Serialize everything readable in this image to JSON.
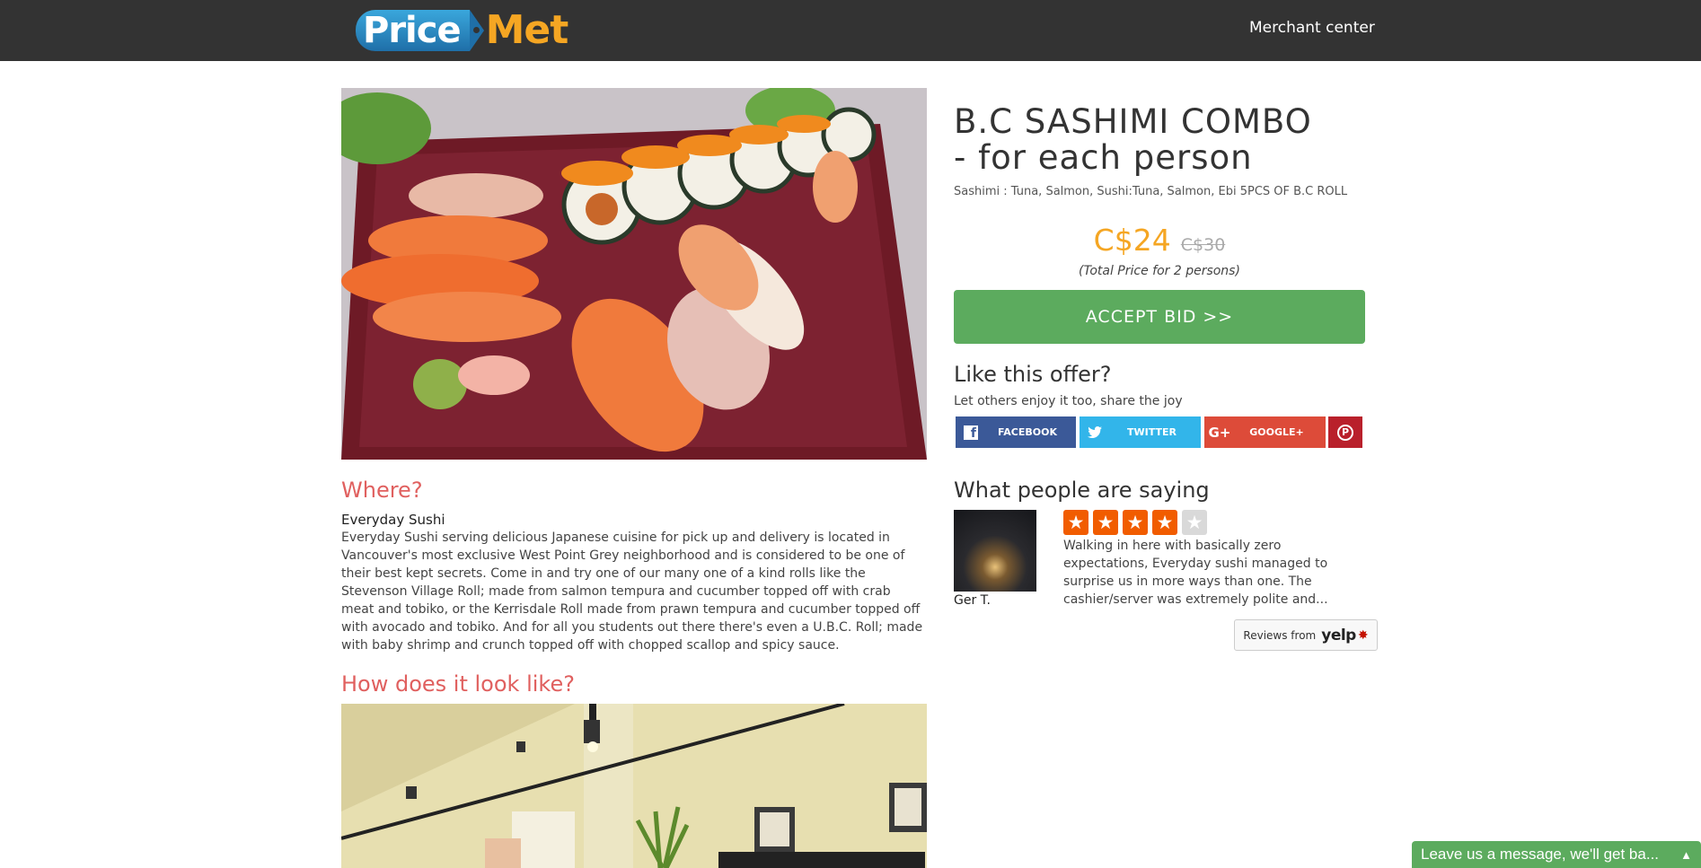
{
  "header": {
    "logo_part1": "Price",
    "logo_part2": "Met",
    "merchant_link": "Merchant center"
  },
  "deal": {
    "title": "B.C SASHIMI COMBO - for each person",
    "subtitle": "Sashimi : Tuna, Salmon, Sushi:Tuna, Salmon, Ebi 5PCS OF B.C ROLL",
    "price_new": "C$24",
    "price_old": "C$30",
    "price_note": "(Total Price for 2 persons)",
    "accept_label": "ACCEPT BID >>"
  },
  "share": {
    "heading": "Like this offer?",
    "subheading": "Let others enjoy it too, share the joy",
    "facebook": "FACEBOOK",
    "twitter": "TWITTER",
    "google_icon": "G+",
    "google": "GOOGLE+",
    "pinterest_icon": "P"
  },
  "where": {
    "heading": "Where?",
    "business_name": "Everyday Sushi",
    "description": "Everyday Sushi serving delicious Japanese cuisine for pick up and delivery is located in Vancouver's most exclusive West Point Grey neighborhood and is considered to be one of their best kept secrets. Come in and try one of our many one of a kind rolls like the Stevenson Village Roll; made from salmon tempura and cucumber topped off with crab meat and tobiko, or the Kerrisdale Roll made from prawn tempura and cucumber topped off with avocado and tobiko. And for all you students out there there's even a U.B.C. Roll; made with baby shrimp and crunch topped off with chopped scallop and spicy sauce."
  },
  "look": {
    "heading": "How does it look like?"
  },
  "reviews": {
    "heading": "What people are saying",
    "reviewer_name": "Ger T.",
    "rating": 4,
    "rating_max": 5,
    "text": "Walking in here with basically zero expectations, Everyday sushi managed to surprise us in more ways than one. The cashier/server was extremely polite and...",
    "yelp_from": "Reviews from",
    "yelp_word": "yelp"
  },
  "chat": {
    "message": "Leave us a message, we'll get ba..."
  },
  "colors": {
    "header_bg": "#333333",
    "accent_green": "#5cab5e",
    "price_orange": "#f5a623",
    "section_red": "#e0605f",
    "star_orange": "#f15c00"
  }
}
